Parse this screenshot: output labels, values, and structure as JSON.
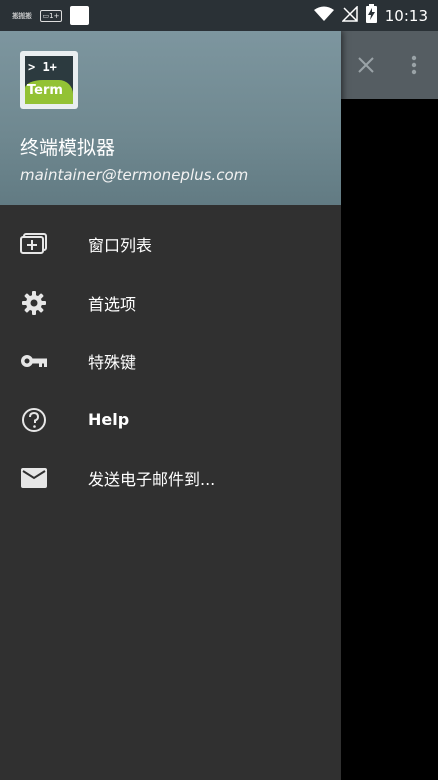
{
  "status_bar": {
    "left_text": "搬搬搬",
    "badge": "▭1+",
    "time": "10:13"
  },
  "toolbar": {
    "close_icon": "close-icon",
    "more_icon": "more-vert-icon"
  },
  "drawer": {
    "app_icon": {
      "prompt": "> 1+",
      "term": "Term"
    },
    "title": "终端模拟器",
    "email": "maintainer@termoneplus.com",
    "items": [
      {
        "label": "窗口列表",
        "icon": "window-list-icon"
      },
      {
        "label": "首选项",
        "icon": "gear-icon"
      },
      {
        "label": "特殊键",
        "icon": "key-icon"
      },
      {
        "label": "Help",
        "icon": "help-icon"
      },
      {
        "label": "发送电子邮件到...",
        "icon": "mail-icon"
      }
    ]
  },
  "colors": {
    "status_bar": "#2a3136",
    "toolbar": "#555d62",
    "drawer_bg": "#303030",
    "header_bg": "#6f8890",
    "term_green": "#93c235"
  }
}
